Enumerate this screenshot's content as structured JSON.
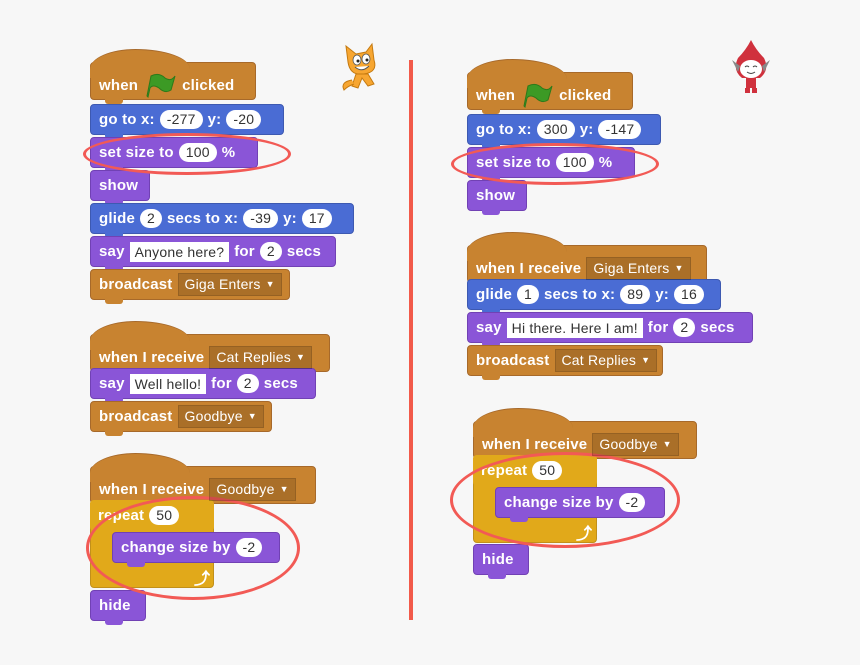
{
  "sprites": {
    "left": {
      "name": "cat-sprite"
    },
    "right": {
      "name": "giga-sprite"
    }
  },
  "colors": {
    "events": "#c88330",
    "motion": "#4a6cd4",
    "looks": "#8a55d7",
    "control": "#e1a91a",
    "highlight": "#f25a55"
  },
  "left": {
    "script1": {
      "hat": {
        "when": "when",
        "clicked": "clicked"
      },
      "goto": {
        "label": "go to x:",
        "x": "-277",
        "ylabel": "y:",
        "y": "-20"
      },
      "setsize": {
        "label": "set size to",
        "value": "100",
        "unit": "%"
      },
      "show": {
        "label": "show"
      },
      "glide": {
        "label": "glide",
        "secs": "2",
        "secs_label": "secs to x:",
        "x": "-39",
        "ylabel": "y:",
        "y": "17"
      },
      "say": {
        "label": "say",
        "text": "Anyone here?",
        "for": "for",
        "secs": "2",
        "secs_label": "secs"
      },
      "broadcast": {
        "label": "broadcast",
        "message": "Giga Enters"
      }
    },
    "script2": {
      "hat": {
        "label": "when I receive",
        "message": "Cat Replies"
      },
      "say": {
        "label": "say",
        "text": "Well hello!",
        "for": "for",
        "secs": "2",
        "secs_label": "secs"
      },
      "broadcast": {
        "label": "broadcast",
        "message": "Goodbye"
      }
    },
    "script3": {
      "hat": {
        "label": "when I receive",
        "message": "Goodbye"
      },
      "repeat": {
        "label": "repeat",
        "count": "50"
      },
      "change": {
        "label": "change size by",
        "value": "-2"
      },
      "hide": {
        "label": "hide"
      }
    }
  },
  "right": {
    "script1": {
      "hat": {
        "when": "when",
        "clicked": "clicked"
      },
      "goto": {
        "label": "go to x:",
        "x": "300",
        "ylabel": "y:",
        "y": "-147"
      },
      "setsize": {
        "label": "set size to",
        "value": "100",
        "unit": "%"
      },
      "show": {
        "label": "show"
      }
    },
    "script2": {
      "hat": {
        "label": "when I receive",
        "message": "Giga Enters"
      },
      "glide": {
        "label": "glide",
        "secs": "1",
        "secs_label": "secs to x:",
        "x": "89",
        "ylabel": "y:",
        "y": "16"
      },
      "say": {
        "label": "say",
        "text": "Hi there. Here I am!",
        "for": "for",
        "secs": "2",
        "secs_label": "secs"
      },
      "broadcast": {
        "label": "broadcast",
        "message": "Cat Replies"
      }
    },
    "script3": {
      "hat": {
        "label": "when I receive",
        "message": "Goodbye"
      },
      "repeat": {
        "label": "repeat",
        "count": "50"
      },
      "change": {
        "label": "change size by",
        "value": "-2"
      },
      "hide": {
        "label": "hide"
      }
    }
  },
  "repeat_arrow": "↲"
}
